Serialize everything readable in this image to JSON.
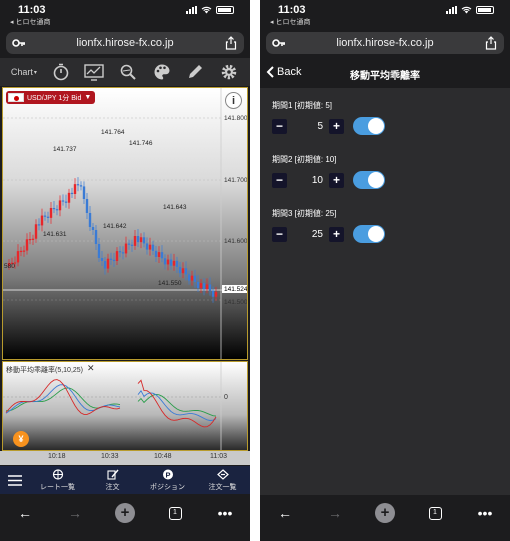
{
  "status": {
    "time": "11:03",
    "back_app": "◂ ヒロセ通商"
  },
  "browser": {
    "url": "lionfx.hirose-fx.co.jp",
    "tab_count": "1"
  },
  "chart_screen": {
    "toolbar": {
      "chart_select": "Chart"
    },
    "pair_label": "USD/JPY 1分 Bid",
    "info": "i",
    "price_labels": [
      "141.800",
      "141.700",
      "141.600",
      "141.524",
      "141.500"
    ],
    "annotations": [
      "141.764",
      "141.737",
      "141.746",
      "141.631",
      "141.642",
      "141.643",
      "141.550",
      "580"
    ],
    "indicator_title": "移動平均乖離率(5,10,25)",
    "indicator_zero": "0",
    "yen_button": "¥",
    "time_labels": [
      "10:18",
      "10:33",
      "10:48",
      "11:03"
    ],
    "bottom_nav": [
      {
        "label": "レート一覧"
      },
      {
        "label": "注文"
      },
      {
        "label": "ポジション"
      },
      {
        "label": "注文一覧"
      }
    ]
  },
  "settings_screen": {
    "back_label": "Back",
    "title": "移動平均乖離率",
    "periods": [
      {
        "label": "期間1 [初期値: 5]",
        "value": "5",
        "enabled": true
      },
      {
        "label": "期間2 [初期値: 10]",
        "value": "10",
        "enabled": true
      },
      {
        "label": "期間3 [初期値: 25]",
        "value": "25",
        "enabled": true
      }
    ]
  },
  "colors": {
    "up": "#e8262a",
    "down": "#3a7bd5",
    "accent": "#b89b2d",
    "toggle": "#4a9de0",
    "nav_bg": "#1a2340"
  }
}
